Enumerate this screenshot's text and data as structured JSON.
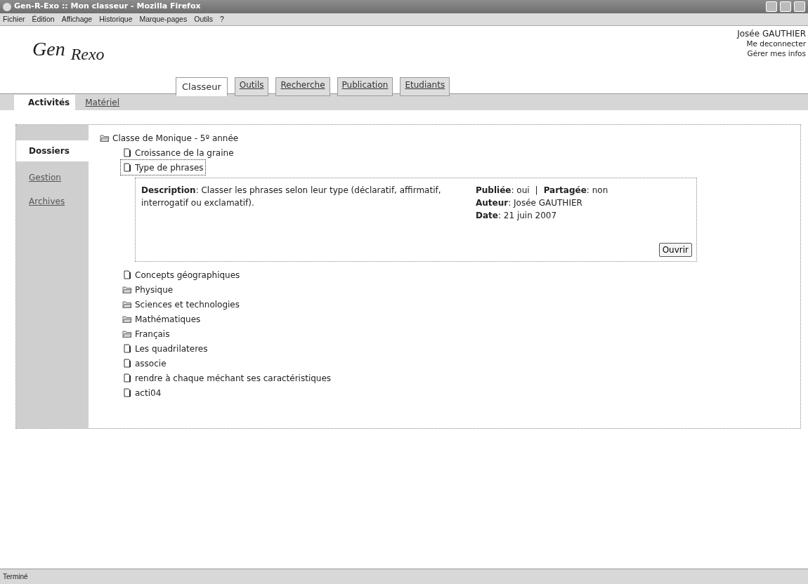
{
  "window": {
    "title": "Gen-R-Exo :: Mon classeur - Mozilla Firefox"
  },
  "menu": [
    "Fichier",
    "Édition",
    "Affichage",
    "Historique",
    "Marque-pages",
    "Outils",
    "?"
  ],
  "logo": {
    "part_1": "Gen",
    "part_2": "Rexo"
  },
  "user": {
    "name": "Josée GAUTHIER",
    "links": [
      "Me deconnecter",
      "Gérer mes infos"
    ]
  },
  "tabs": [
    {
      "label": "Classeur",
      "selected": true
    },
    {
      "label": "Outils",
      "selected": false
    },
    {
      "label": "Recherche",
      "selected": false
    },
    {
      "label": "Publication",
      "selected": false
    },
    {
      "label": "Etudiants",
      "selected": false
    }
  ],
  "subtabs": [
    {
      "label": "Activités",
      "selected": true
    },
    {
      "label": "Matériel",
      "selected": false
    }
  ],
  "side_tabs": [
    {
      "label": "Dossiers",
      "selected": true
    },
    {
      "label": "Gestion",
      "selected": false
    },
    {
      "label": "Archives",
      "selected": false
    }
  ],
  "tree": {
    "label": "Classe de Monique - 5º année",
    "kind": "folder",
    "children": [
      {
        "label": "Croissance de la graine",
        "kind": "file",
        "selected": false
      },
      {
        "label": "Type de phrases",
        "kind": "file",
        "selected": true,
        "details": {
          "description": "**Description**: Classer les phrases selon leur type (déclaratif, affirmatif, interrogatif ou exclamatif).",
          "published": "**Publiée**: oui",
          "separator": "|",
          "shared": "**Partagée**: non",
          "author": "**Auteur**: Josée GAUTHIER",
          "date": "**Date**: 21 juin 2007",
          "button": "Ouvrir"
        }
      },
      {
        "label": "Concepts géographiques",
        "kind": "file",
        "selected": false
      },
      {
        "label": "Physique",
        "kind": "folder",
        "selected": false
      },
      {
        "label": "Sciences et technologies",
        "kind": "folder",
        "selected": false
      },
      {
        "label": "Mathématiques",
        "kind": "folder",
        "selected": false
      },
      {
        "label": "Français",
        "kind": "folder",
        "selected": false
      },
      {
        "label": "Les quadrilateres",
        "kind": "file",
        "selected": false
      },
      {
        "label": "associe",
        "kind": "file",
        "selected": false
      },
      {
        "label": "rendre à chaque méchant ses caractéristiques",
        "kind": "file",
        "selected": false
      },
      {
        "label": "acti04",
        "kind": "file",
        "selected": false
      }
    ]
  },
  "status_bar": {
    "text": "Terminé"
  }
}
